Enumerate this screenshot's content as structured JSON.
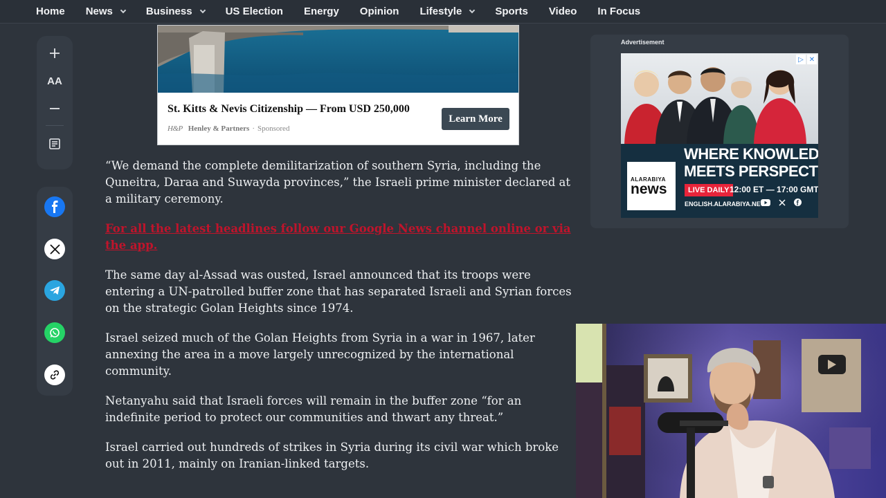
{
  "nav": {
    "items": [
      {
        "label": "Home",
        "has_menu": false
      },
      {
        "label": "News",
        "has_menu": true
      },
      {
        "label": "Business",
        "has_menu": true
      },
      {
        "label": "US Election",
        "has_menu": false
      },
      {
        "label": "Energy",
        "has_menu": false
      },
      {
        "label": "Opinion",
        "has_menu": false
      },
      {
        "label": "Lifestyle",
        "has_menu": true
      },
      {
        "label": "Sports",
        "has_menu": false
      },
      {
        "label": "Video",
        "has_menu": false
      },
      {
        "label": "In Focus",
        "has_menu": false
      }
    ]
  },
  "tools": {
    "increase_icon": "plus-icon",
    "font_size_label": "AA",
    "decrease_icon": "minus-icon",
    "article_icon": "document-icon"
  },
  "share": {
    "icons": [
      "facebook-icon",
      "x-icon",
      "telegram-icon",
      "whatsapp-icon",
      "link-icon"
    ]
  },
  "sponsored": {
    "title": "St. Kitts & Nevis Citizenship — From USD 250,000",
    "logo_text": "H&P",
    "brand": "Henley & Partners",
    "separator": "·",
    "tag": "Sponsored",
    "button_label": "Learn More"
  },
  "article": {
    "p1": "“We demand the complete demilitarization of southern Syria, including the Quneitra, Daraa and Suwayda provinces,” the Israeli prime minister declared at a military ceremony.",
    "cta": "For all the latest headlines follow our Google News channel online or via the app.",
    "p2": "The same day al-Assad was ousted, Israel announced that its troops were entering a UN-patrolled buffer zone that has separated Israeli and Syrian forces on the strategic Golan Heights since 1974.",
    "p3": "Israel seized much of the Golan Heights from Syria in a war in 1967, later annexing the area in a move largely unrecognized by the international community.",
    "p4": "Netanyahu said that Israeli forces will remain in the buffer zone “for an indefinite period to protect our communities and thwart any threat.”",
    "p5": "Israel carried out hundreds of strikes in Syria during its civil war which broke out in 2011, mainly on Iranian-linked targets."
  },
  "ad": {
    "label": "Advertisement",
    "logo_line1": "ALARABIYA",
    "logo_line2": "news",
    "headline1": "WHERE KNOWLEDGE",
    "headline2": "MEETS PERSPECTIVE",
    "live": "LIVE DAILY",
    "hours": "12:00 ET — 17:00 GMT",
    "url": "ENGLISH.ALARABIYA.NET",
    "adchoices_icon": "adchoices-icon",
    "close_icon": "close-icon"
  },
  "colors": {
    "page_bg": "#2e343c",
    "panel_bg": "#353c45",
    "cta_red": "#c0142b",
    "button_dark": "#3b4853"
  }
}
